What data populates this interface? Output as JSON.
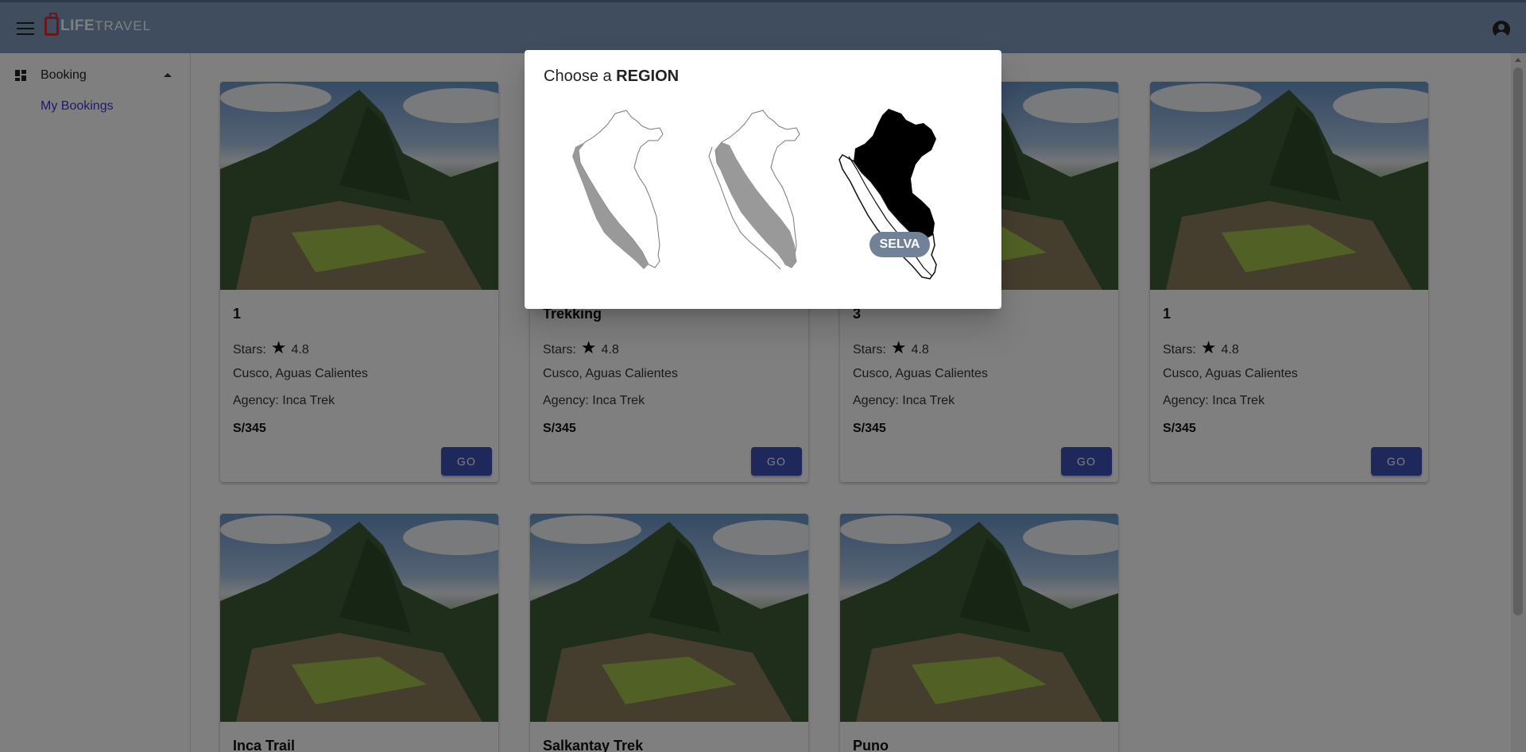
{
  "header": {
    "logo_life": "LIFE",
    "logo_travel": "TRAVEL",
    "menu_icon": "menu-icon",
    "account_icon": "account-circle-icon"
  },
  "sidebar": {
    "group_label": "Booking",
    "group_icon": "dashboard-icon",
    "items": [
      {
        "label": "My Bookings"
      }
    ]
  },
  "cards": [
    {
      "title": "1",
      "stars_label": "Stars:",
      "rating": "4.8",
      "location": "Cusco, Aguas Calientes",
      "agency": "Agency: Inca Trek",
      "price": "S/345",
      "button": "GO"
    },
    {
      "title": "Trekking",
      "stars_label": "Stars:",
      "rating": "4.8",
      "location": "Cusco, Aguas Calientes",
      "agency": "Agency: Inca Trek",
      "price": "S/345",
      "button": "GO"
    },
    {
      "title": "3",
      "stars_label": "Stars:",
      "rating": "4.8",
      "location": "Cusco, Aguas Calientes",
      "agency": "Agency: Inca Trek",
      "price": "S/345",
      "button": "GO"
    },
    {
      "title": "1",
      "stars_label": "Stars:",
      "rating": "4.8",
      "location": "Cusco, Aguas Calientes",
      "agency": "Agency: Inca Trek",
      "price": "S/345",
      "button": "GO"
    },
    {
      "title": "Inca Trail"
    },
    {
      "title": "Salkantay Trek"
    },
    {
      "title": "Puno"
    }
  ],
  "dialog": {
    "title_prefix": "Choose a ",
    "title_strong": "REGION",
    "regions": [
      {
        "name": "costa-region",
        "highlighted": false
      },
      {
        "name": "sierra-region",
        "highlighted": false
      },
      {
        "name": "selva-region",
        "highlighted": true,
        "label": "SELVA"
      }
    ]
  },
  "colors": {
    "appbar": "#7f9bbd",
    "accent_button": "#3f51b5",
    "active_link": "#3f35d4",
    "chip": "#718298"
  }
}
